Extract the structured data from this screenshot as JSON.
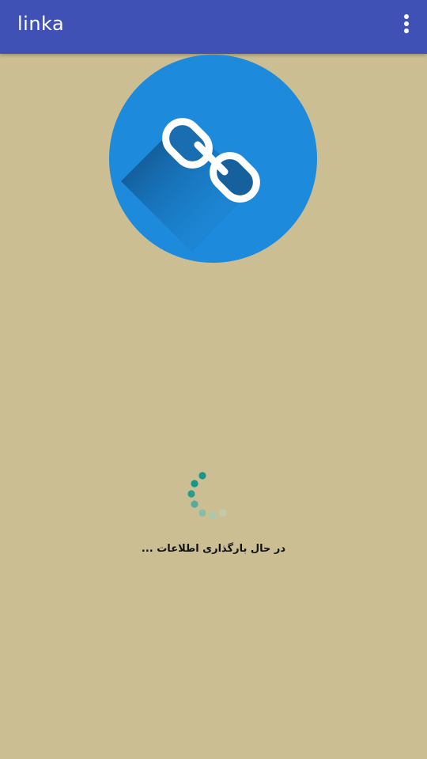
{
  "app_bar": {
    "title": "linka",
    "menu_icon": "more-vert-icon"
  },
  "logo": {
    "icon": "link-chain-icon",
    "circle_color": "#1d8adb"
  },
  "loading": {
    "icon": "loading-spinner-icon",
    "message": "در حال بارگذاری اطلاعات ..."
  },
  "colors": {
    "app_bar": "#3f51b5",
    "background": "#cbbe93",
    "spinner": "#16978a"
  }
}
